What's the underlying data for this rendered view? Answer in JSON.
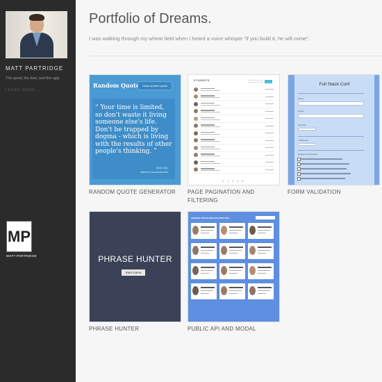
{
  "sidebar": {
    "name": "Matt Partridge",
    "tagline": "The good, the bad, and the ugly.",
    "learn_more": "Learn More →",
    "logo_text": "MP",
    "logo_name": "Matt Partridge"
  },
  "main": {
    "title": "Portfolio of Dreams.",
    "subtitle": "I was walking through my wheat field when I heard a voice whisper \"if you build it, he will come\"."
  },
  "projects": [
    {
      "label": "Random Quote Generator",
      "preview": {
        "title": "Random Quotes",
        "button": "Show another quote",
        "quote": "“ Your time is limited, so don't waste it living someone else's life. Don't be trapped by dogma - which is living with the results of other people's thinking. ”",
        "source": "Steve Jobs",
        "citation": "Stanford Commencement"
      }
    },
    {
      "label": "Page Pagination and Filtering",
      "preview": {
        "heading": "STUDENTS",
        "pages": "1 2 3 4 5"
      }
    },
    {
      "label": "Form Validation",
      "preview": {
        "title": "Full Stack Conf"
      }
    },
    {
      "label": "Phrase Hunter",
      "preview": {
        "title": "PHRASE HUNTER",
        "button": "Start Game"
      }
    },
    {
      "label": "Public API and Modal",
      "preview": {
        "heading": "AWESOME STARTUP EMPLOYEE DIRECTORY"
      }
    }
  ],
  "colors": {
    "sidebar": "#2b2b2b",
    "random_quote": "#4a9ad4",
    "form_validation": "#7aa6e6",
    "phrase_hunter": "#3b4257",
    "public_api": "#5e8fe0"
  }
}
